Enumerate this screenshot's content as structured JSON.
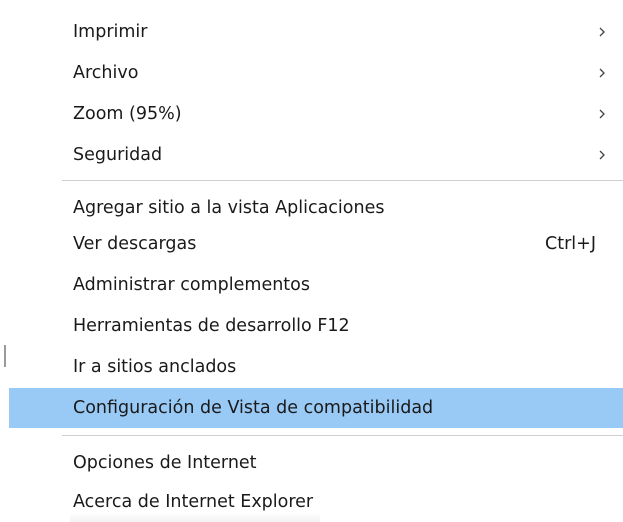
{
  "menu": {
    "items": [
      {
        "label": "Imprimir",
        "submenu": true
      },
      {
        "label": "Archivo",
        "submenu": true
      },
      {
        "label": "Zoom (95%)",
        "submenu": true
      },
      {
        "label": "Seguridad",
        "submenu": true
      },
      {
        "label": "Agregar sitio a la vista Aplicaciones"
      },
      {
        "label": "Ver descargas",
        "shortcut": "Ctrl+J"
      },
      {
        "label": "Administrar complementos"
      },
      {
        "label": "Herramientas de desarrollo F12"
      },
      {
        "label": "Ir a sitios anclados"
      },
      {
        "label": "Configuración de Vista de compatibilidad",
        "highlighted": true
      },
      {
        "label": "Opciones de Internet"
      },
      {
        "label": "Acerca de Internet Explorer"
      }
    ]
  },
  "colors": {
    "highlight": "#99c9f5",
    "separator": "#cfcfcf",
    "text": "#1a1a1a"
  },
  "icons": {
    "submenu": "chevron-right-icon"
  }
}
